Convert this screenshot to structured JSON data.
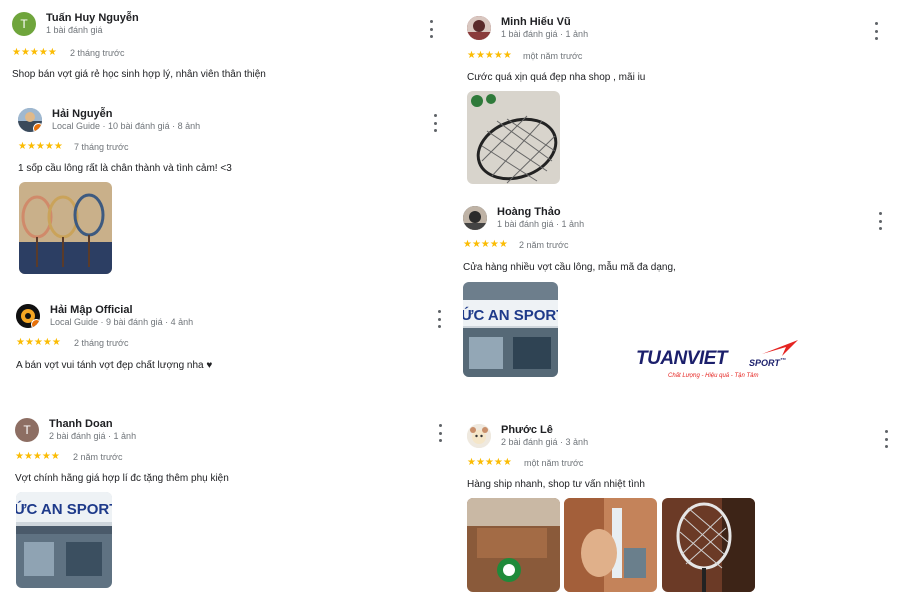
{
  "reviews": [
    {
      "name": "Tuấn Huy Nguyễn",
      "meta": "1 bài đánh giá",
      "stars": "★★★★★",
      "ago": "2 tháng trước",
      "text": "Shop bán vợt giá rẻ học sinh hợp lý, nhân viên thân thiện",
      "avatar_letter": "T",
      "avatar_color": "#6fa53c"
    },
    {
      "name": "Hải Nguyễn",
      "meta": "Local Guide · 10 bài đánh giá · 8 ảnh",
      "stars": "★★★★★",
      "ago": "7 tháng trước",
      "text": "1 sốp cầu lông rất là chân thành và tình cảm! <3"
    },
    {
      "name": "Hải Mập Official",
      "meta": "Local Guide · 9 bài đánh giá · 4 ảnh",
      "stars": "★★★★★",
      "ago": "2 tháng trước",
      "text": "A bán vợt vui tánh vợt đẹp chất lượng nha ♥"
    },
    {
      "name": "Thanh Doan",
      "meta": "2 bài đánh giá · 1 ảnh",
      "stars": "★★★★★",
      "ago": "2 năm trước",
      "text": "Vợt chính hãng giá hợp lí đc tặng thêm phụ kiện",
      "avatar_letter": "T",
      "avatar_color": "#8d6e63"
    },
    {
      "name": "Minh Hiếu Vũ",
      "meta": "1 bài đánh giá · 1 ảnh",
      "stars": "★★★★★",
      "ago": "một năm trước",
      "text": "Cước quá xịn quá đẹp nha shop , mãi iu"
    },
    {
      "name": "Hoàng Thảo",
      "meta": "1 bài đánh giá · 1 ảnh",
      "stars": "★★★★★",
      "ago": "2 năm trước",
      "text": "Cửa hàng nhiều vợt cầu lông, mẫu mã đa dạng,",
      "photo_sign": "ỨC AN SPORT"
    },
    {
      "name": "Phước Lê",
      "meta": "2 bài đánh giá · 3 ảnh",
      "stars": "★★★★★",
      "ago": "một năm trước",
      "text": "Hàng ship nhanh, shop tư vấn nhiệt tình"
    }
  ],
  "thanh_doan_photo_sign": "ỨC AN SPORT",
  "brand": {
    "name": "TUANVIET",
    "sport": "SPORT",
    "tm": "™",
    "tagline": "Chất Lượng - Hiệu quả - Tận Tâm",
    "color": "#1b1f6b",
    "accent": "#e52421"
  },
  "icons": {
    "more": "more-vert-icon",
    "star": "star-icon"
  }
}
